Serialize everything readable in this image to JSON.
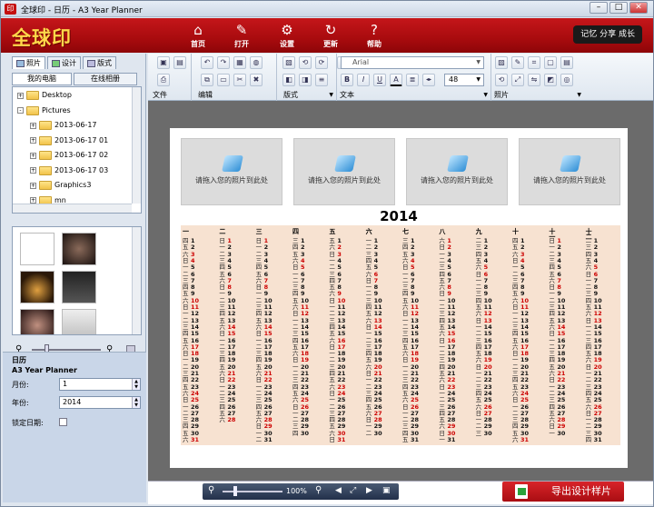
{
  "window": {
    "title": "全球印 - 日历 - A3 Year Planner"
  },
  "brand": {
    "logo": "全球印",
    "slogan": "记忆 分享 成长"
  },
  "nav": [
    {
      "label": "首页",
      "icon": "home-icon"
    },
    {
      "label": "打开",
      "icon": "open-icon"
    },
    {
      "label": "设置",
      "icon": "gear-icon"
    },
    {
      "label": "更新",
      "icon": "refresh-icon"
    },
    {
      "label": "帮助",
      "icon": "help-icon"
    }
  ],
  "left_tabs": [
    "照片",
    "设计",
    "版式"
  ],
  "sub_tabs": [
    "我的电脑",
    "在线相册"
  ],
  "tree": [
    {
      "label": "Desktop",
      "level": 0,
      "expander": "+"
    },
    {
      "label": "Pictures",
      "level": 0,
      "expander": "-"
    },
    {
      "label": "2013-06-17",
      "level": 1,
      "expander": "+"
    },
    {
      "label": "2013-06-17 01",
      "level": 1,
      "expander": "+"
    },
    {
      "label": "2013-06-17 02",
      "level": 1,
      "expander": "+"
    },
    {
      "label": "2013-06-17 03",
      "level": 1,
      "expander": "+"
    },
    {
      "label": "Graphics3",
      "level": 1,
      "expander": "+"
    },
    {
      "label": "mn",
      "level": 1,
      "expander": "+"
    }
  ],
  "properties": {
    "section": "日历",
    "name": "A3 Year Planner",
    "month_label": "月份:",
    "month_value": "1",
    "year_label": "年份:",
    "year_value": "2014",
    "lock_label": "锁定日期:"
  },
  "ribbon": {
    "groups": [
      "文件",
      "编辑",
      "版式",
      "文本",
      "照片"
    ],
    "font": "Arial",
    "font_size": "48",
    "bold": "B",
    "italic": "I",
    "underline": "U",
    "text_color": "A"
  },
  "canvas": {
    "slot_text": "请拖入您的照片到此处",
    "year": "2014",
    "month_count": 12
  },
  "calendar": {
    "weekdays": [
      "一",
      "二",
      "三",
      "四",
      "五",
      "六",
      "日"
    ],
    "days_in_month": [
      31,
      28,
      31,
      30,
      31,
      30,
      31,
      31,
      30,
      31,
      30,
      31
    ],
    "first_weekday": [
      3,
      6,
      6,
      2,
      4,
      0,
      2,
      5,
      1,
      3,
      6,
      1
    ],
    "month_names": [
      "一",
      "二",
      "三",
      "四",
      "五",
      "六",
      "七",
      "八",
      "九",
      "十",
      "十一",
      "十二"
    ]
  },
  "bottom": {
    "zoom": "100%",
    "export_label": "导出设计样片"
  },
  "colors": {
    "brand_red": "#b30f13",
    "band": "#f7e2d1",
    "canvas_bg": "#6b6b6b"
  }
}
